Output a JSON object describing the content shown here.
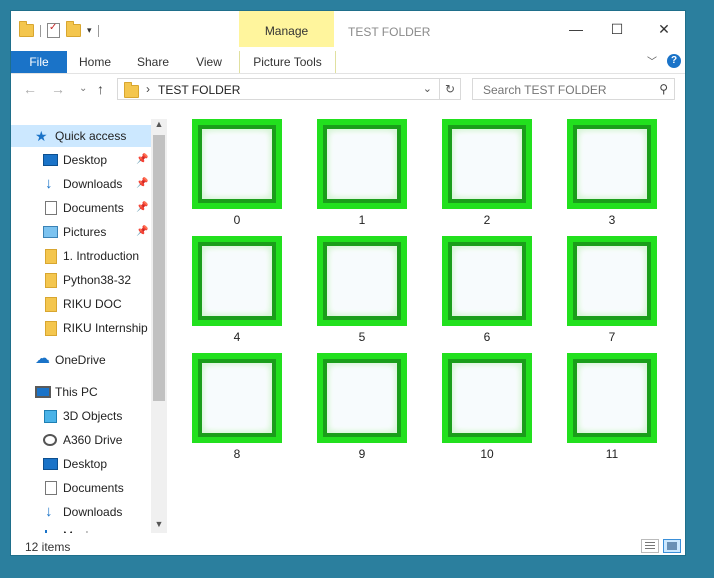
{
  "window": {
    "title": "TEST FOLDER",
    "context_tab": "Manage",
    "controls": {
      "minimize": "—",
      "maximize": "☐",
      "close": "✕"
    }
  },
  "ribbon": {
    "tabs": [
      "File",
      "Home",
      "Share",
      "View",
      "Picture Tools"
    ]
  },
  "address": {
    "path": "TEST FOLDER",
    "search_placeholder": "Search TEST FOLDER"
  },
  "nav": {
    "items": [
      {
        "label": "Quick access",
        "icon": "star-icon"
      },
      {
        "label": "Desktop",
        "icon": "desktop-icon",
        "pinned": true
      },
      {
        "label": "Downloads",
        "icon": "download-icon",
        "pinned": true
      },
      {
        "label": "Documents",
        "icon": "documents-icon",
        "pinned": true
      },
      {
        "label": "Pictures",
        "icon": "pictures-icon",
        "pinned": true
      },
      {
        "label": "1. Introduction",
        "icon": "folder-icon"
      },
      {
        "label": "Python38-32",
        "icon": "folder-icon"
      },
      {
        "label": "RIKU DOC",
        "icon": "folder-icon"
      },
      {
        "label": "RIKU Internship I",
        "icon": "folder-icon"
      },
      {
        "label": "OneDrive",
        "icon": "cloud-icon"
      },
      {
        "label": "This PC",
        "icon": "computer-icon"
      },
      {
        "label": "3D Objects",
        "icon": "3d-objects-icon"
      },
      {
        "label": "A360 Drive",
        "icon": "a360-drive-icon"
      },
      {
        "label": "Desktop",
        "icon": "desktop-icon"
      },
      {
        "label": "Documents",
        "icon": "documents-icon"
      },
      {
        "label": "Downloads",
        "icon": "download-icon"
      },
      {
        "label": "Music",
        "icon": "music-icon"
      }
    ]
  },
  "files": [
    "0",
    "1",
    "2",
    "3",
    "4",
    "5",
    "6",
    "7",
    "8",
    "9",
    "10",
    "11"
  ],
  "status": {
    "count": "12 items"
  },
  "colors": {
    "accent": "#1a73c8",
    "thumb_border": "#22e01e",
    "manage_tab": "#fff59d",
    "desktop_bg": "#2b7f9e"
  }
}
